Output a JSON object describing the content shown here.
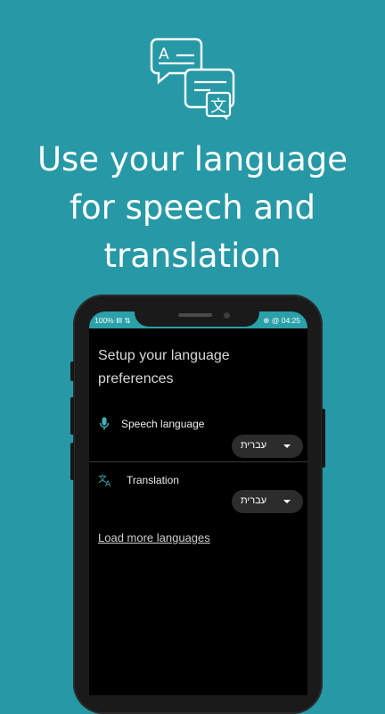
{
  "hero": {
    "icon": "translate-bubbles-icon",
    "headline_lines": [
      "Use your language",
      "for speech and",
      "translation"
    ],
    "bubble_glyph_a": "A",
    "bubble_glyph_b": "文"
  },
  "status_bar": {
    "left": "100% ‖‖ ⇅",
    "right": "⊗ @ 04:25"
  },
  "screen": {
    "title": "Setup your language preferences",
    "speech": {
      "icon": "mic-icon",
      "label": "Speech language",
      "value": "עברית"
    },
    "translation": {
      "icon": "translate-icon",
      "label": "Translation",
      "value": "עברית"
    },
    "load_more": "Load more languages"
  },
  "colors": {
    "background": "#2799a6",
    "status_bar": "#2aa0a8",
    "accent": "#3fb3b8"
  }
}
